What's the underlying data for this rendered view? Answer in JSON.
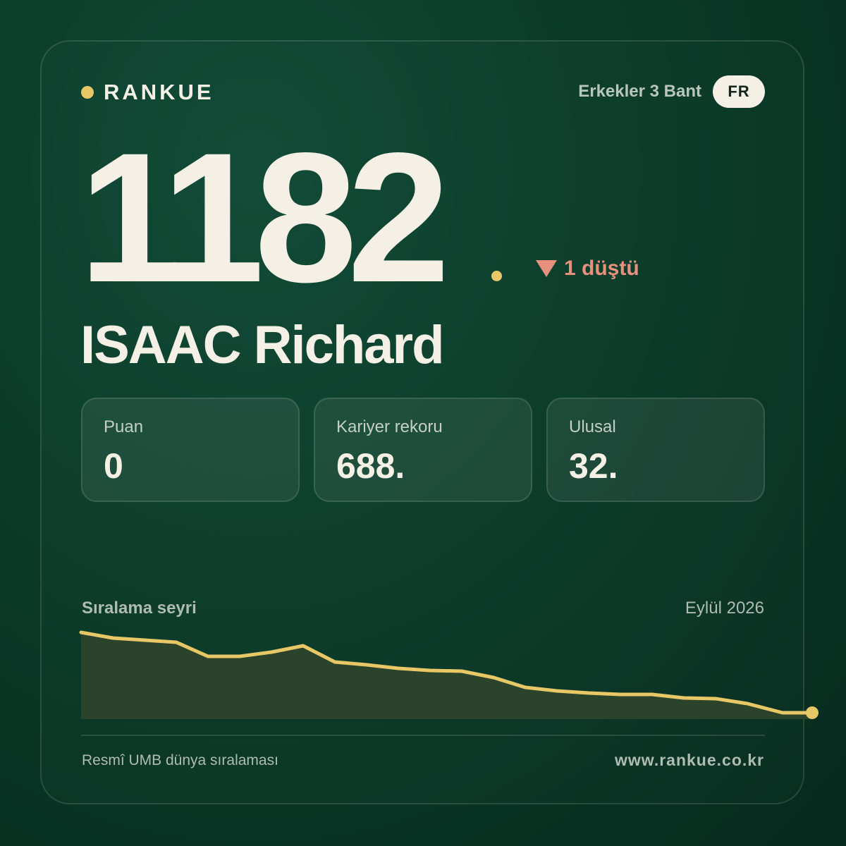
{
  "brand": {
    "name": "RANKUE"
  },
  "header": {
    "category": "Erkekler 3 Bant",
    "country": "FR"
  },
  "ranking": {
    "position": "1182",
    "change_label": "1 düştü",
    "change_direction": "down"
  },
  "player": {
    "name": "ISAAC Richard"
  },
  "stats": [
    {
      "label": "Puan",
      "value": "0"
    },
    {
      "label": "Kariyer rekoru",
      "value": "688."
    },
    {
      "label": "Ulusal",
      "value": "32."
    }
  ],
  "trend": {
    "title": "Sıralama seyri",
    "date": "Eylül 2026"
  },
  "footer": {
    "source": "Resmî UMB dünya sıralaması",
    "website": "www.rankue.co.kr"
  },
  "colors": {
    "accent": "#e8c766",
    "down": "#e8907e",
    "text": "#f5f0e6",
    "area_fill": "#2b432a"
  }
}
